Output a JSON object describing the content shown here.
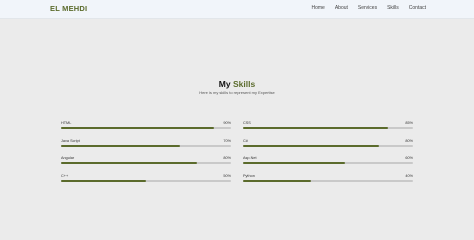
{
  "nav": {
    "brand": "EL MEHDI",
    "items": [
      "Home",
      "About",
      "Services",
      "Skills",
      "Contact"
    ]
  },
  "section": {
    "title_prefix": "My ",
    "title_accent": "Skills",
    "subtitle": "Here is my skills to represent my Expertise"
  },
  "skills": [
    {
      "name": "HTML",
      "percent_label": "90%",
      "level": 0.9
    },
    {
      "name": "CSS",
      "percent_label": "85%",
      "level": 0.85
    },
    {
      "name": "Java Script",
      "percent_label": "70%",
      "level": 0.7
    },
    {
      "name": "C#",
      "percent_label": "80%",
      "level": 0.8
    },
    {
      "name": "Angular",
      "percent_label": "80%",
      "level": 0.8
    },
    {
      "name": "Asp.Net",
      "percent_label": "60%",
      "level": 0.6
    },
    {
      "name": "C++",
      "percent_label": "50%",
      "level": 0.5
    },
    {
      "name": "Python",
      "percent_label": "40%",
      "level": 0.4
    }
  ],
  "colors": {
    "accent": "#5b6b2c",
    "track": "#c9c9c9",
    "background": "#ebebeb"
  }
}
